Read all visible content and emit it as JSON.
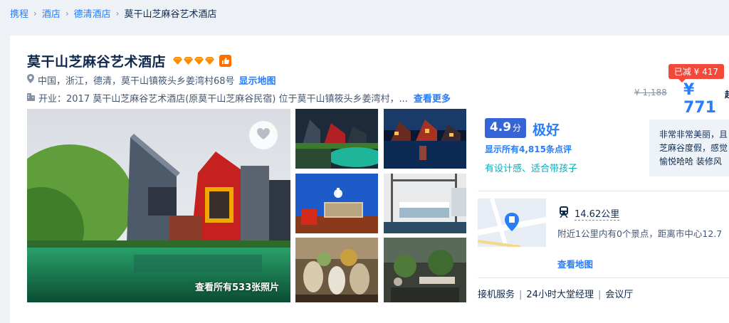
{
  "breadcrumb": {
    "items": [
      "携程",
      "酒店",
      "德清酒店"
    ],
    "current": "莫干山芝麻谷艺术酒店"
  },
  "hotel": {
    "name": "莫干山芝麻谷艺术酒店",
    "diamond_count": 4,
    "address": "中国，浙江，德清，莫干山镇筱头乡姜湾村68号",
    "show_map_label": "显示地图",
    "description": "开业：2017  莫干山芝麻谷艺术酒店(原莫干山芝麻谷民宿) 位于莫干山镇筱头乡姜湾村，...",
    "more_label": "查看更多"
  },
  "price": {
    "discount": "已减 ¥ 417",
    "original": "¥ 1,188",
    "current": "¥ 771",
    "suffix": "起"
  },
  "photos": {
    "all_label": "查看所有533张照片"
  },
  "rating": {
    "score": "4.9",
    "unit": "分",
    "word": "极好",
    "reviews_link": "显示所有4,815条点评",
    "tags": "有设计感、适合带孩子",
    "quote_lines": [
      "非常非常美丽，且",
      "芝麻谷度假，感觉",
      "愉悦哈哈 装修风"
    ]
  },
  "location": {
    "transit_distance": "14.62公里",
    "nearby": "附近1公里内有0个景点，距离市中心12.7",
    "map_link": "查看地图"
  },
  "facilities": [
    "接机服务",
    "24小时大堂经理",
    "会议厅"
  ],
  "colors": {
    "accent_blue": "#287dfa",
    "score_bg": "#3565d7",
    "discount_red": "#f2493b",
    "diamond_orange": "#ff8a00",
    "tag_teal": "#06aebd"
  }
}
